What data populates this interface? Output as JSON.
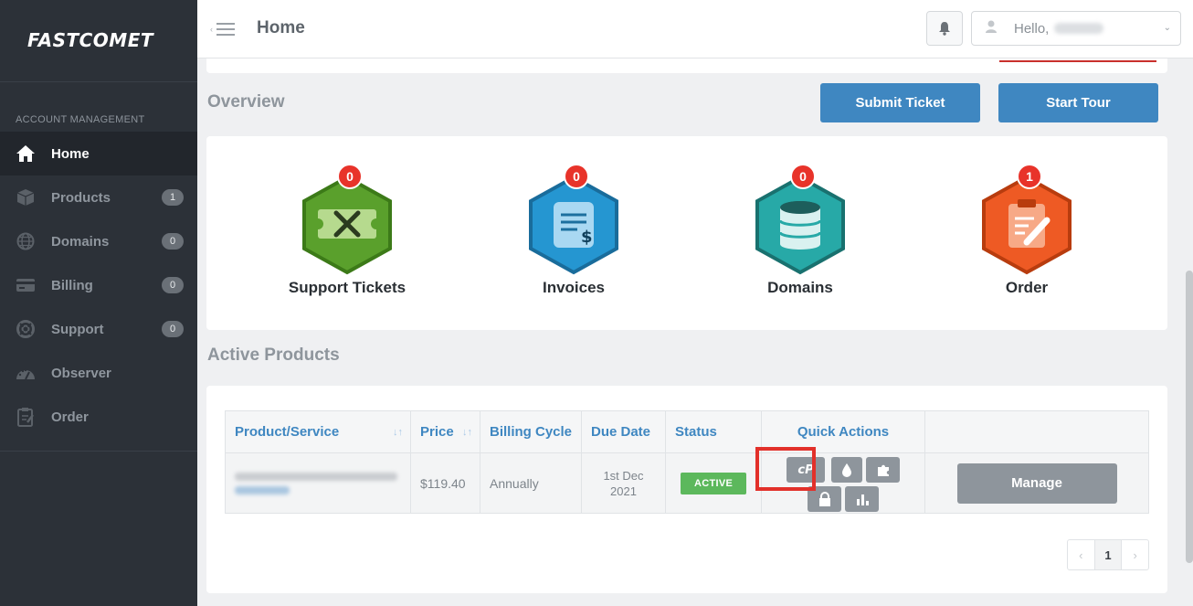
{
  "brand": {
    "logo": "FASTCOMET"
  },
  "sidebar": {
    "section_title": "ACCOUNT MANAGEMENT",
    "items": [
      {
        "label": "Home",
        "icon": "home-icon",
        "badge": ""
      },
      {
        "label": "Products",
        "icon": "box-icon",
        "badge": "1"
      },
      {
        "label": "Domains",
        "icon": "globe-icon",
        "badge": "0"
      },
      {
        "label": "Billing",
        "icon": "credit-card-icon",
        "badge": "0"
      },
      {
        "label": "Support",
        "icon": "lifebuoy-icon",
        "badge": "0"
      },
      {
        "label": "Observer",
        "icon": "dashboard-icon",
        "badge": ""
      },
      {
        "label": "Order",
        "icon": "clipboard-icon",
        "badge": ""
      }
    ]
  },
  "header": {
    "title": "Home",
    "greeting": "Hello,"
  },
  "overview": {
    "title": "Overview",
    "submit_ticket": "Submit Ticket",
    "start_tour": "Start Tour",
    "stats": [
      {
        "label": "Support Tickets",
        "count": "0",
        "color": "#5aa02c",
        "icon": "tools-icon"
      },
      {
        "label": "Invoices",
        "count": "0",
        "color": "#2596d1",
        "icon": "invoice-icon"
      },
      {
        "label": "Domains",
        "count": "0",
        "color": "#27a9a7",
        "icon": "database-icon"
      },
      {
        "label": "Order",
        "count": "1",
        "color": "#ee5a24",
        "icon": "order-clipboard-icon"
      }
    ]
  },
  "active_products": {
    "title": "Active Products",
    "columns": [
      "Product/Service",
      "Price",
      "Billing Cycle",
      "Due Date",
      "Status",
      "Quick Actions",
      ""
    ],
    "rows": [
      {
        "price": "$119.40",
        "cycle": "Annually",
        "due_line1": "1st Dec",
        "due_line2": "2021",
        "status": "ACTIVE",
        "action": "Manage"
      }
    ],
    "pagination": {
      "current": "1"
    }
  },
  "colors": {
    "primary": "#3f87c1",
    "sidebar": "#2c3138",
    "active_status": "#5cb85c",
    "highlight": "#e2302a"
  }
}
